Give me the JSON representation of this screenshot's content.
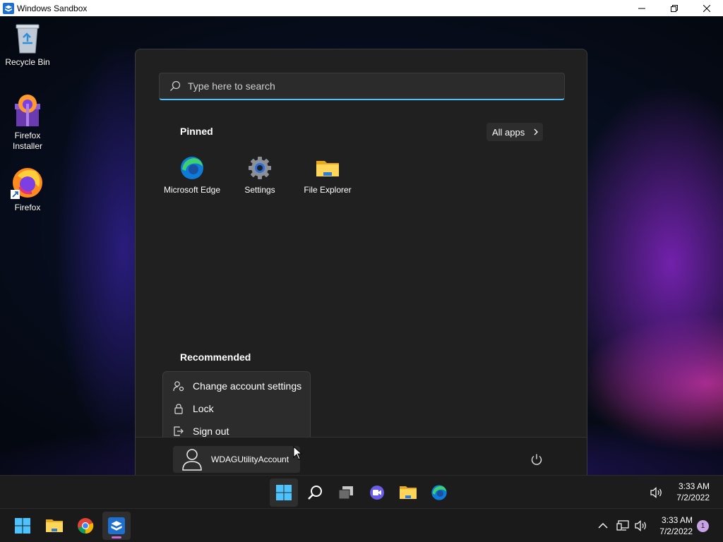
{
  "window": {
    "title": "Windows Sandbox"
  },
  "desktop": {
    "icons": [
      {
        "label": "Recycle Bin"
      },
      {
        "label": "Firefox\nInstaller"
      },
      {
        "label": "Firefox"
      }
    ]
  },
  "start_menu": {
    "search_placeholder": "Type here to search",
    "pinned_title": "Pinned",
    "all_apps_label": "All apps",
    "pinned_apps": [
      {
        "label": "Microsoft Edge",
        "icon": "edge-icon"
      },
      {
        "label": "Settings",
        "icon": "gear-icon"
      },
      {
        "label": "File Explorer",
        "icon": "folder-icon"
      }
    ],
    "recommended_title": "Recommended",
    "account_menu": [
      {
        "label": "Change account settings",
        "icon": "account-settings-icon"
      },
      {
        "label": "Lock",
        "icon": "lock-icon"
      },
      {
        "label": "Sign out",
        "icon": "sign-out-icon"
      }
    ],
    "user_name": "WDAGUtilityAccount"
  },
  "inner_taskbar": {
    "time": "3:33 AM",
    "date": "7/2/2022"
  },
  "host_taskbar": {
    "time": "3:33 AM",
    "date": "7/2/2022",
    "notification_count": "1"
  },
  "colors": {
    "accent": "#4cc2ff",
    "start_bg": "#202020",
    "taskbar_bg": "#1c1c1c"
  }
}
